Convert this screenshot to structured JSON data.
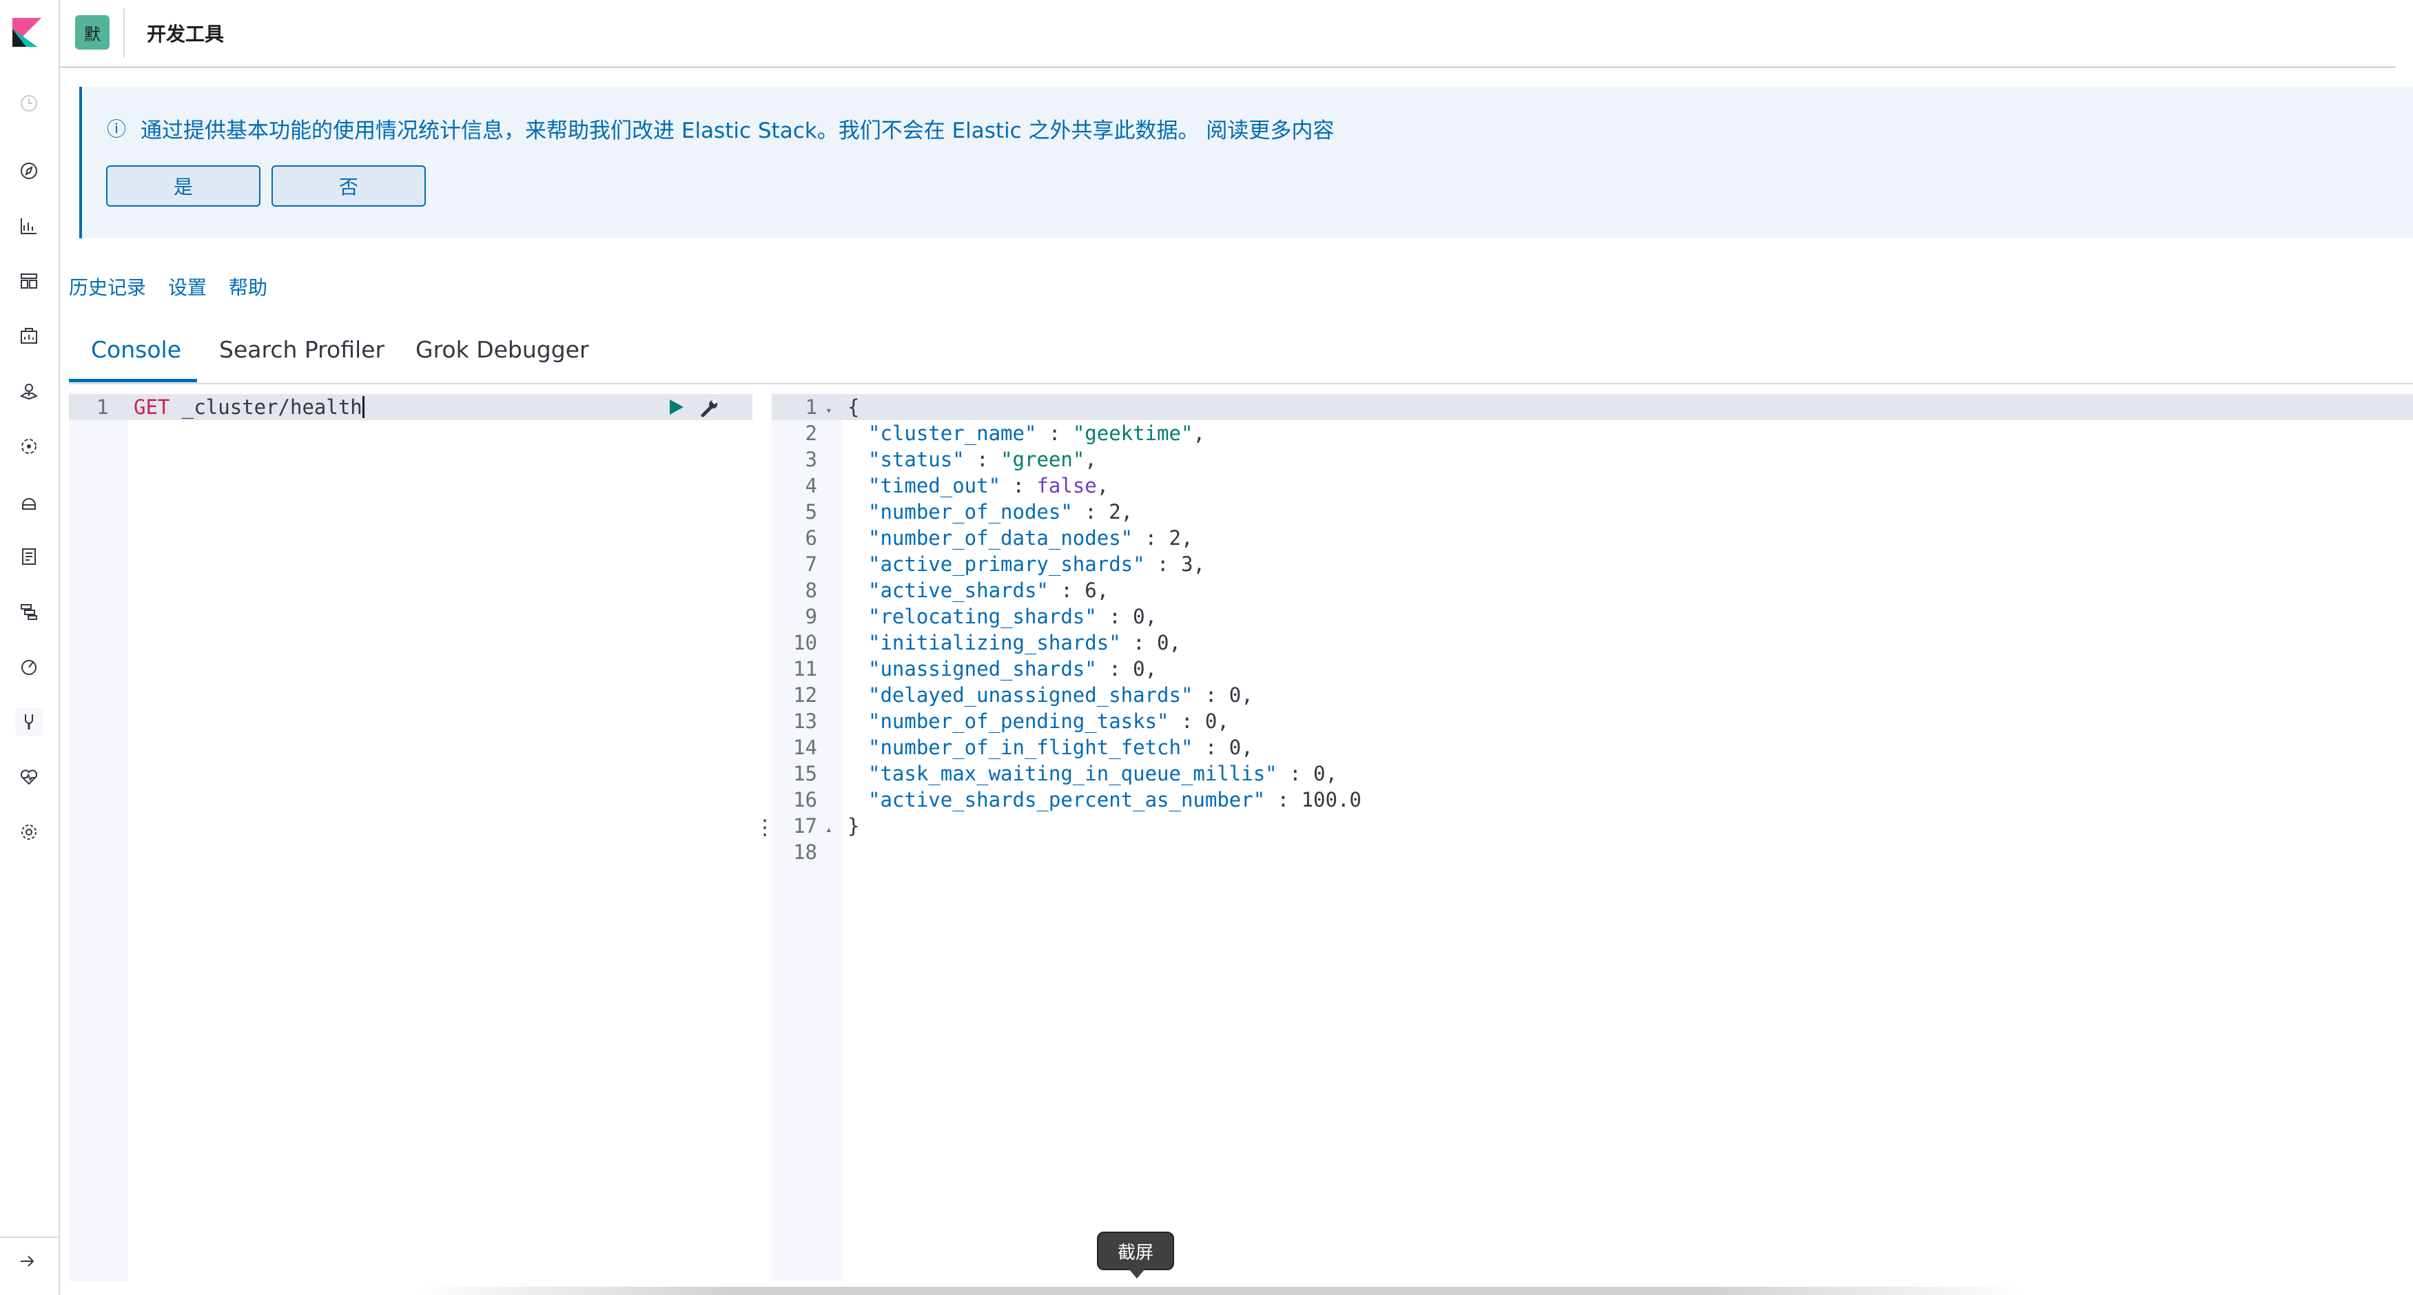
{
  "header": {
    "space_initial": "默",
    "app_title": "开发工具"
  },
  "callout": {
    "text": "通过提供基本功能的使用情况统计信息，来帮助我们改进 Elastic Stack。我们不会在 Elastic 之外共享此数据。 阅读更多内容",
    "yes_label": "是",
    "no_label": "否"
  },
  "top_links": {
    "history": "历史记录",
    "settings": "设置",
    "help": "帮助"
  },
  "tabs": [
    {
      "label": "Console"
    },
    {
      "label": "Search Profiler"
    },
    {
      "label": "Grok Debugger"
    }
  ],
  "request": {
    "line_number": "1",
    "method": "GET",
    "path": "_cluster/health"
  },
  "response": {
    "lines": [
      {
        "n": "1",
        "fold": "▾",
        "text": "{"
      },
      {
        "n": "2",
        "key": "\"cluster_name\"",
        "val": "\"geektime\"",
        "type": "s",
        "comma": ","
      },
      {
        "n": "3",
        "key": "\"status\"",
        "val": "\"green\"",
        "type": "s",
        "comma": ","
      },
      {
        "n": "4",
        "key": "\"timed_out\"",
        "val": "false",
        "type": "b",
        "comma": ","
      },
      {
        "n": "5",
        "key": "\"number_of_nodes\"",
        "val": "2",
        "type": "n",
        "comma": ","
      },
      {
        "n": "6",
        "key": "\"number_of_data_nodes\"",
        "val": "2",
        "type": "n",
        "comma": ","
      },
      {
        "n": "7",
        "key": "\"active_primary_shards\"",
        "val": "3",
        "type": "n",
        "comma": ","
      },
      {
        "n": "8",
        "key": "\"active_shards\"",
        "val": "6",
        "type": "n",
        "comma": ","
      },
      {
        "n": "9",
        "key": "\"relocating_shards\"",
        "val": "0",
        "type": "n",
        "comma": ","
      },
      {
        "n": "10",
        "key": "\"initializing_shards\"",
        "val": "0",
        "type": "n",
        "comma": ","
      },
      {
        "n": "11",
        "key": "\"unassigned_shards\"",
        "val": "0",
        "type": "n",
        "comma": ","
      },
      {
        "n": "12",
        "key": "\"delayed_unassigned_shards\"",
        "val": "0",
        "type": "n",
        "comma": ","
      },
      {
        "n": "13",
        "key": "\"number_of_pending_tasks\"",
        "val": "0",
        "type": "n",
        "comma": ","
      },
      {
        "n": "14",
        "key": "\"number_of_in_flight_fetch\"",
        "val": "0",
        "type": "n",
        "comma": ","
      },
      {
        "n": "15",
        "key": "\"task_max_waiting_in_queue_millis\"",
        "val": "0",
        "type": "n",
        "comma": ","
      },
      {
        "n": "16",
        "key": "\"active_shards_percent_as_number\"",
        "val": "100.0",
        "type": "n",
        "comma": ""
      },
      {
        "n": "17",
        "fold": "▴",
        "text": "}"
      },
      {
        "n": "18",
        "text": ""
      }
    ]
  },
  "tooltip": {
    "label": "截屏"
  },
  "colors": {
    "accent": "#006bb4",
    "string": "#017d73",
    "boolean": "#6f3cc8",
    "method": "#c7254e"
  }
}
